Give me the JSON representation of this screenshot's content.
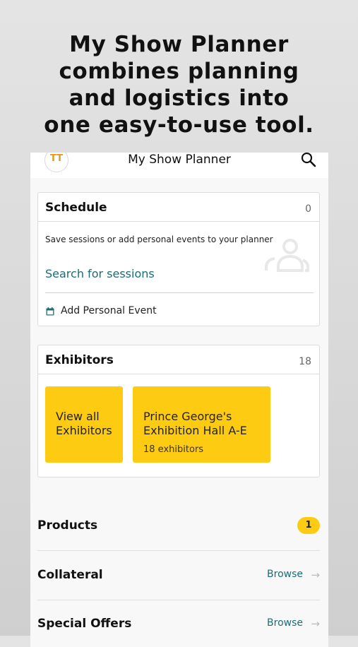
{
  "headline": {
    "lines": [
      "My Show Planner",
      "combines planning",
      "and logistics into",
      "one easy-to-use tool."
    ]
  },
  "app": {
    "title": "My Show Planner",
    "avatar_initials": "TT",
    "accent_color": "#fdcb12",
    "link_color": "#1b6d74"
  },
  "schedule": {
    "title": "Schedule",
    "count": "0",
    "description": "Save sessions or add personal events to your planner",
    "search_link": "Search for sessions",
    "add_event": "Add Personal Event"
  },
  "exhibitors": {
    "title": "Exhibitors",
    "count": "18",
    "tiles": [
      {
        "label_line1": "View all",
        "label_line2": "Exhibitors"
      },
      {
        "label_line1": "Prince George's",
        "label_line2": "Exhibition Hall A-E",
        "sub": "18 exhibitors"
      }
    ]
  },
  "rows": {
    "products": {
      "label": "Products",
      "badge": "1"
    },
    "collateral": {
      "label": "Collateral",
      "action": "Browse",
      "arrow": "→"
    },
    "special_offers": {
      "label": "Special Offers",
      "action": "Browse",
      "arrow": "→"
    }
  }
}
